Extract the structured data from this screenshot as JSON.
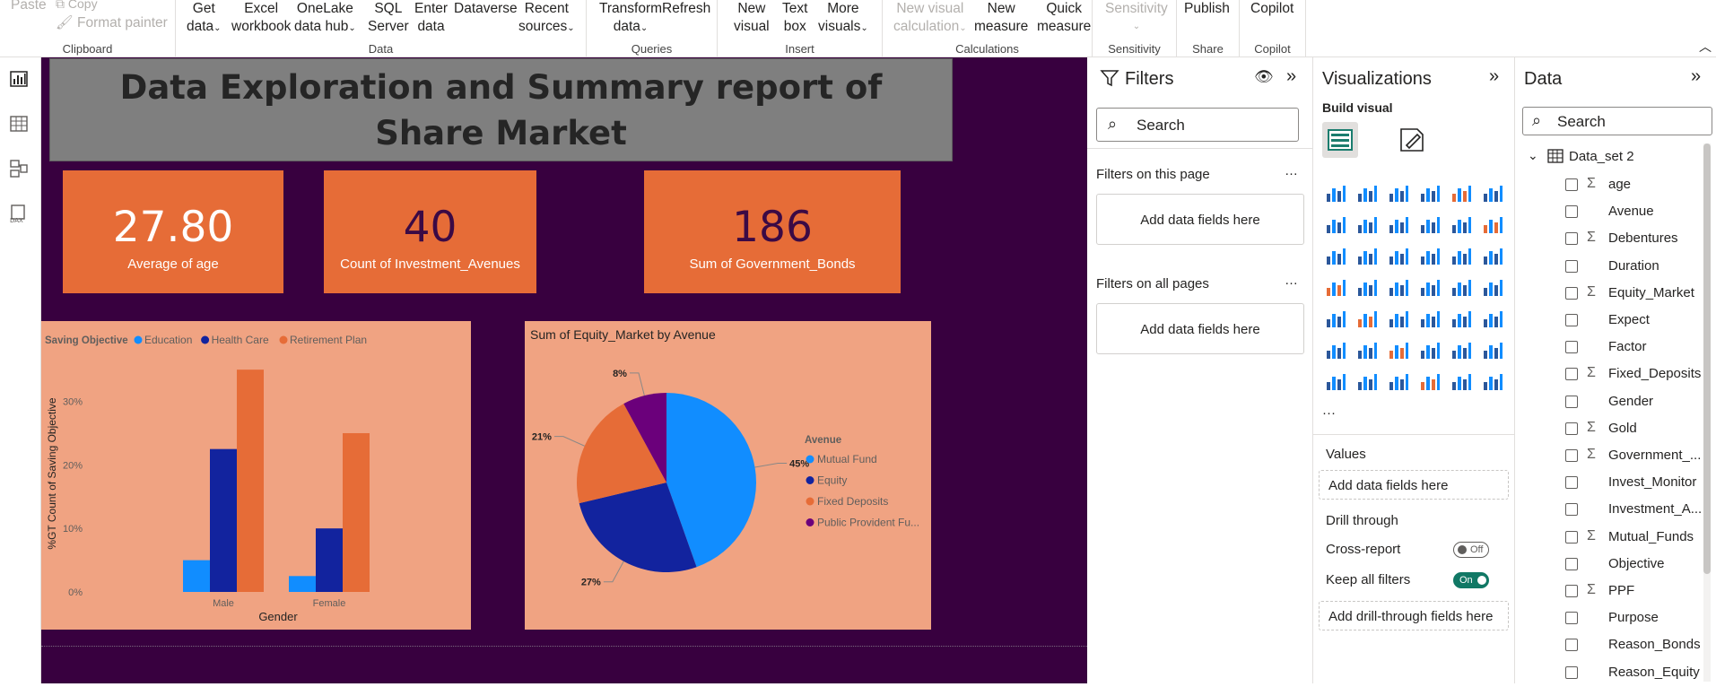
{
  "ribbon": {
    "clipboard": {
      "label": "Clipboard",
      "paste": "Paste",
      "copy": "Copy",
      "format_painter": "Format painter"
    },
    "data": {
      "label": "Data",
      "get_data": [
        "Get",
        "data"
      ],
      "excel": [
        "Excel",
        "workbook"
      ],
      "onelake": [
        "OneLake",
        "data hub"
      ],
      "sql": [
        "SQL",
        "Server"
      ],
      "enter": [
        "Enter",
        "data"
      ],
      "dataverse": "Dataverse",
      "recent": [
        "Recent",
        "sources"
      ]
    },
    "queries": {
      "label": "Queries",
      "transform": [
        "Transform",
        "data"
      ],
      "refresh": "Refresh"
    },
    "insert": {
      "label": "Insert",
      "new_visual": [
        "New",
        "visual"
      ],
      "text_box": [
        "Text",
        "box"
      ],
      "more_visuals": [
        "More",
        "visuals"
      ]
    },
    "calculations": {
      "label": "Calculations",
      "new_visual_calc": [
        "New visual",
        "calculation"
      ],
      "new_measure": [
        "New",
        "measure"
      ],
      "quick_measure": [
        "Quick",
        "measure"
      ]
    },
    "sensitivity": {
      "label": "Sensitivity",
      "btn": "Sensitivity"
    },
    "share": {
      "label": "Share",
      "publish": "Publish"
    },
    "copilot": {
      "label": "Copilot",
      "btn": "Copilot"
    }
  },
  "report": {
    "title": "Data Exploration and Summary report of Share Market",
    "cards": [
      {
        "value": "27.80",
        "label": "Average of age",
        "color": "#ffffff"
      },
      {
        "value": "40",
        "label": "Count of Investment_Avenues",
        "color": "#3b0a45"
      },
      {
        "value": "186",
        "label": "Sum of Government_Bonds",
        "color": "#3b0a45"
      }
    ]
  },
  "chart_data": [
    {
      "type": "bar",
      "legend_title": "Saving Objective",
      "categories": [
        "Male",
        "Female"
      ],
      "series": [
        {
          "name": "Education",
          "values": [
            5,
            2.5
          ],
          "color": "#118dff"
        },
        {
          "name": "Health Care",
          "values": [
            22.5,
            10
          ],
          "color": "#12239e"
        },
        {
          "name": "Retirement Plan",
          "values": [
            35,
            25
          ],
          "color": "#e66c37"
        }
      ],
      "xlabel": "Gender",
      "ylabel": "%GT Count of Saving Objective",
      "ylim": [
        0,
        37
      ],
      "yticks": [
        "0%",
        "10%",
        "20%",
        "30%"
      ],
      "ytick_values": [
        0,
        10,
        20,
        30
      ],
      "grid": false,
      "legend": "top-left"
    },
    {
      "type": "pie",
      "title": "Sum of Equity_Market by Avenue",
      "legend_title": "Avenue",
      "slices": [
        {
          "name": "Mutual Fund",
          "value": 45,
          "label": "45%",
          "color": "#118dff"
        },
        {
          "name": "Equity",
          "value": 27,
          "label": "27%",
          "color": "#12239e"
        },
        {
          "name": "Fixed Deposits",
          "value": 21,
          "label": "21%",
          "color": "#e66c37"
        },
        {
          "name": "Public Provident Fu...",
          "value": 8,
          "label": "8%",
          "color": "#6b007b"
        }
      ],
      "legend": "right"
    }
  ],
  "filters": {
    "title": "Filters",
    "search": "Search",
    "on_page": "Filters on this page",
    "on_all": "Filters on all pages",
    "add": "Add data fields here",
    "more": "…"
  },
  "viz": {
    "title": "Visualizations",
    "build": "Build visual",
    "values": "Values",
    "add_values": "Add data fields here",
    "drill": "Drill through",
    "cross": "Cross-report",
    "cross_state": "Off",
    "keep": "Keep all filters",
    "keep_state": "On",
    "add_drill": "Add drill-through fields here",
    "more": "···"
  },
  "data": {
    "title": "Data",
    "search": "Search",
    "table": "Data_set 2",
    "fields": [
      {
        "name": "age",
        "sigma": true
      },
      {
        "name": "Avenue",
        "sigma": false
      },
      {
        "name": "Debentures",
        "sigma": true
      },
      {
        "name": "Duration",
        "sigma": false
      },
      {
        "name": "Equity_Market",
        "sigma": true
      },
      {
        "name": "Expect",
        "sigma": false
      },
      {
        "name": "Factor",
        "sigma": false
      },
      {
        "name": "Fixed_Deposits",
        "sigma": true
      },
      {
        "name": "Gender",
        "sigma": false
      },
      {
        "name": "Gold",
        "sigma": true
      },
      {
        "name": "Government_...",
        "sigma": true
      },
      {
        "name": "Invest_Monitor",
        "sigma": false
      },
      {
        "name": "Investment_A...",
        "sigma": false
      },
      {
        "name": "Mutual_Funds",
        "sigma": true
      },
      {
        "name": "Objective",
        "sigma": false
      },
      {
        "name": "PPF",
        "sigma": true
      },
      {
        "name": "Purpose",
        "sigma": false
      },
      {
        "name": "Reason_Bonds",
        "sigma": false
      },
      {
        "name": "Reason_Equity",
        "sigma": false
      }
    ]
  }
}
